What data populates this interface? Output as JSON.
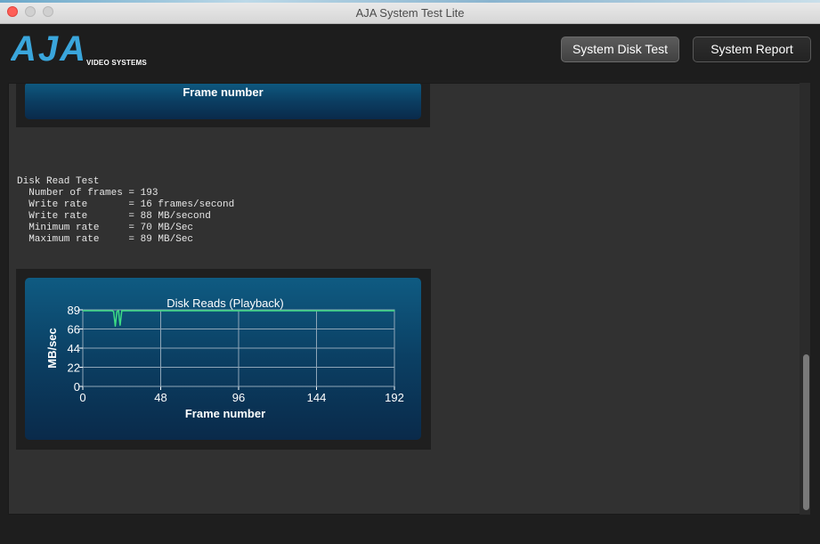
{
  "window": {
    "title": "AJA System Test Lite"
  },
  "header": {
    "logo_text": "AJA",
    "logo_subtext": "VIDEO SYSTEMS",
    "disk_test_button": "System Disk Test",
    "report_button": "System Report"
  },
  "chart1_partial": {
    "xlabel": "Frame number"
  },
  "report": {
    "title": "Disk Read Test",
    "lines": [
      "  Number of frames = 193",
      "  Write rate       = 16 frames/second",
      "  Write rate       = 88 MB/second",
      "  Minimum rate     = 70 MB/Sec",
      "  Maximum rate     = 89 MB/Sec"
    ]
  },
  "chart_data": {
    "type": "line",
    "title": "Disk Reads (Playback)",
    "xlabel": "Frame number",
    "ylabel": "MB/sec",
    "xlim": [
      0,
      192
    ],
    "ylim": [
      0,
      89
    ],
    "x_ticks": [
      "0",
      "48",
      "96",
      "144",
      "192"
    ],
    "y_ticks": [
      "89",
      "66",
      "44",
      "22",
      "0"
    ],
    "grid": true,
    "series": [
      {
        "color": "#3ddc84",
        "x": [
          0,
          10,
          18,
          19,
          20,
          21,
          22,
          23,
          24,
          25,
          30,
          48,
          96,
          144,
          192
        ],
        "y": [
          88,
          88,
          88,
          87,
          70,
          87,
          88,
          71,
          88,
          88,
          88,
          88,
          88,
          88,
          88
        ]
      }
    ],
    "colors": {
      "panel_top": "#0f5b82",
      "panel_bottom": "#0a2a4a",
      "line": "#3ddc84"
    }
  }
}
